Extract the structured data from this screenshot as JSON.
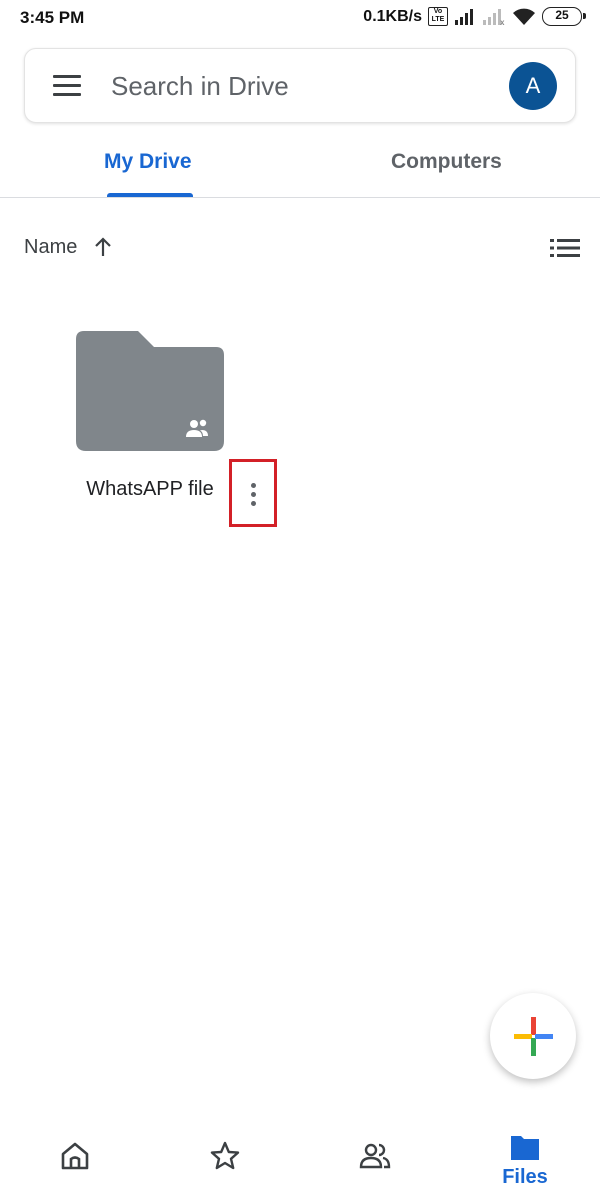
{
  "status_bar": {
    "time": "3:45 PM",
    "network_speed": "0.1KB/s",
    "volte_label": "Vo LTE",
    "battery": "25"
  },
  "search": {
    "placeholder": "Search in Drive",
    "avatar_initial": "A"
  },
  "tabs": [
    {
      "label": "My Drive",
      "selected": true
    },
    {
      "label": "Computers",
      "selected": false
    }
  ],
  "sort": {
    "label": "Name",
    "direction": "ascending"
  },
  "items": [
    {
      "name": "WhatsAPP file",
      "type": "folder",
      "shared": true
    }
  ],
  "bottom_nav": {
    "items": [
      {
        "icon": "home-icon"
      },
      {
        "icon": "star-icon"
      },
      {
        "icon": "shared-icon"
      },
      {
        "icon": "folder-icon",
        "label": "Files",
        "selected": true
      }
    ]
  },
  "colors": {
    "accent": "#1967d2",
    "avatar": "#0b5394",
    "folder": "#80868b",
    "highlight_box": "#d32027"
  }
}
